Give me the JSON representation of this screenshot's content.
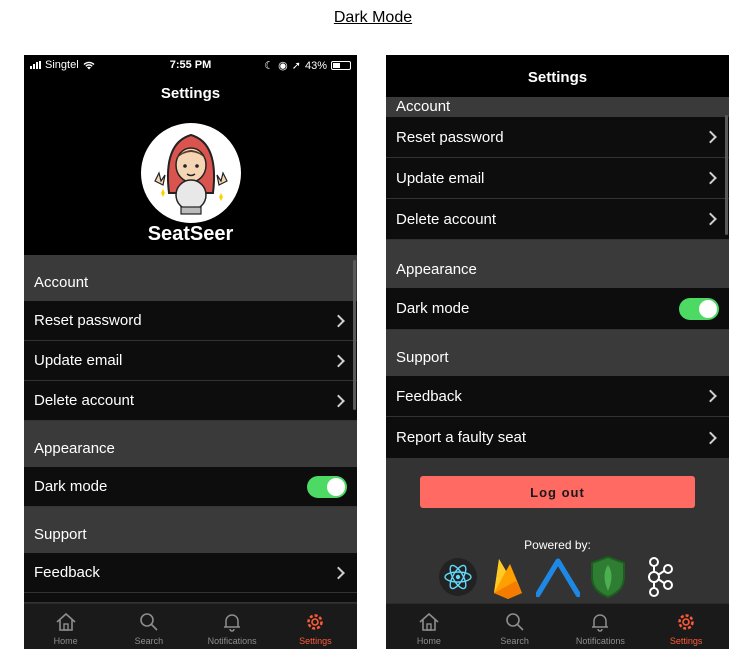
{
  "page_title": "Dark Mode",
  "left_phone": {
    "status": {
      "carrier": "Singtel",
      "time": "7:55 PM",
      "battery": "43%"
    },
    "header": "Settings",
    "brand": "SeatSeer",
    "sections": {
      "account": "Account",
      "appearance": "Appearance",
      "support": "Support"
    },
    "rows": {
      "reset_password": "Reset password",
      "update_email": "Update email",
      "delete_account": "Delete account",
      "dark_mode": "Dark mode",
      "feedback": "Feedback"
    },
    "dark_mode_on": true
  },
  "right_phone": {
    "header": "Settings",
    "sections": {
      "account": "Account",
      "appearance": "Appearance",
      "support": "Support"
    },
    "rows": {
      "reset_password": "Reset password",
      "update_email": "Update email",
      "delete_account": "Delete account",
      "dark_mode": "Dark mode",
      "feedback": "Feedback",
      "report_seat": "Report a faulty seat"
    },
    "dark_mode_on": true,
    "logout": "Log out",
    "powered_by": "Powered by:",
    "logos": [
      "react-logo",
      "firebase-logo",
      "expo-logo",
      "mongodb-logo",
      "kafka-logo"
    ]
  },
  "tabs": [
    {
      "label": "Home",
      "icon": "home-icon"
    },
    {
      "label": "Search",
      "icon": "search-icon"
    },
    {
      "label": "Notifications",
      "icon": "bell-icon"
    },
    {
      "label": "Settings",
      "icon": "gear-icon",
      "active": true
    }
  ],
  "colors": {
    "accent": "#ff5a36",
    "toggle_on": "#4cd964",
    "logout": "#ff6a63",
    "section_bg": "#3a3a3a",
    "row_bg": "#0d0d0d"
  }
}
